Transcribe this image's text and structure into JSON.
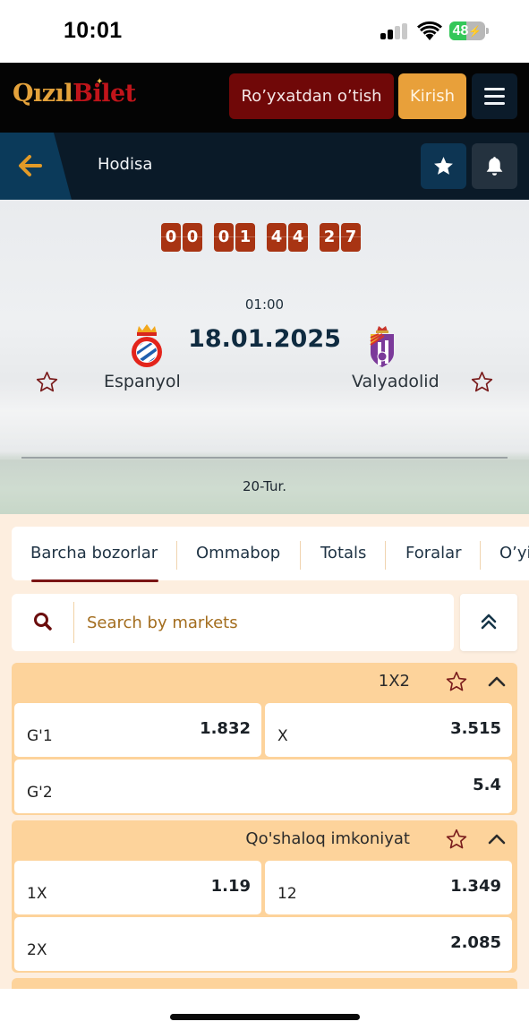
{
  "status_bar": {
    "time": "10:01",
    "battery_percent": 48,
    "battery_label": "48",
    "charging": true,
    "signal_bars_active": 2,
    "signal_bars_total": 4
  },
  "header": {
    "logo_part1": "Qızıl",
    "logo_part2": "Bilet",
    "register_label": "Ro’yxatdan o’tish",
    "login_label": "Kirish",
    "menu_icon": "hamburger-icon"
  },
  "subheader": {
    "back_icon": "arrow-left-icon",
    "title": "Hodisa",
    "favorite_icon": "star-icon",
    "notifications_icon": "bell-icon"
  },
  "match": {
    "countdown": [
      {
        "unit": "days",
        "digits": [
          "0",
          "0"
        ]
      },
      {
        "unit": "hours",
        "digits": [
          "0",
          "1"
        ]
      },
      {
        "unit": "minutes",
        "digits": [
          "4",
          "4"
        ]
      },
      {
        "unit": "seconds",
        "digits": [
          "2",
          "7"
        ]
      }
    ],
    "time": "01:00",
    "date": "18.01.2025",
    "home_team": "Espanyol",
    "away_team": "Valyadolid",
    "round": "20-Tur."
  },
  "markets": {
    "tabs": [
      {
        "label": "Barcha bozorlar",
        "active": true
      },
      {
        "label": "Ommabop",
        "active": false
      },
      {
        "label": "Totals",
        "active": false
      },
      {
        "label": "Foralar",
        "active": false
      },
      {
        "label": "O’yin",
        "active": false
      }
    ],
    "search": {
      "placeholder": "Search by markets",
      "value": ""
    },
    "groups": [
      {
        "title": "1X2",
        "outcomes": [
          {
            "label": "G'1",
            "odds": "1.832"
          },
          {
            "label": "X",
            "odds": "3.515"
          },
          {
            "label": "G'2",
            "odds": "5.4"
          }
        ]
      },
      {
        "title": "Qo'shaloq imkoniyat",
        "outcomes": [
          {
            "label": "1X",
            "odds": "1.19"
          },
          {
            "label": "12",
            "odds": "1.349"
          },
          {
            "label": "2X",
            "odds": "2.085"
          }
        ]
      }
    ]
  },
  "colors": {
    "header_bg": "#040404",
    "register_bg": "#700808",
    "login_bg": "#e8a03a",
    "subheader_bg": "#0a1a28",
    "countdown_bg": "#a83413",
    "market_header_bg": "#fdd39b",
    "markets_bg": "#fdeedf",
    "accent_dark_red": "#7a1414"
  }
}
